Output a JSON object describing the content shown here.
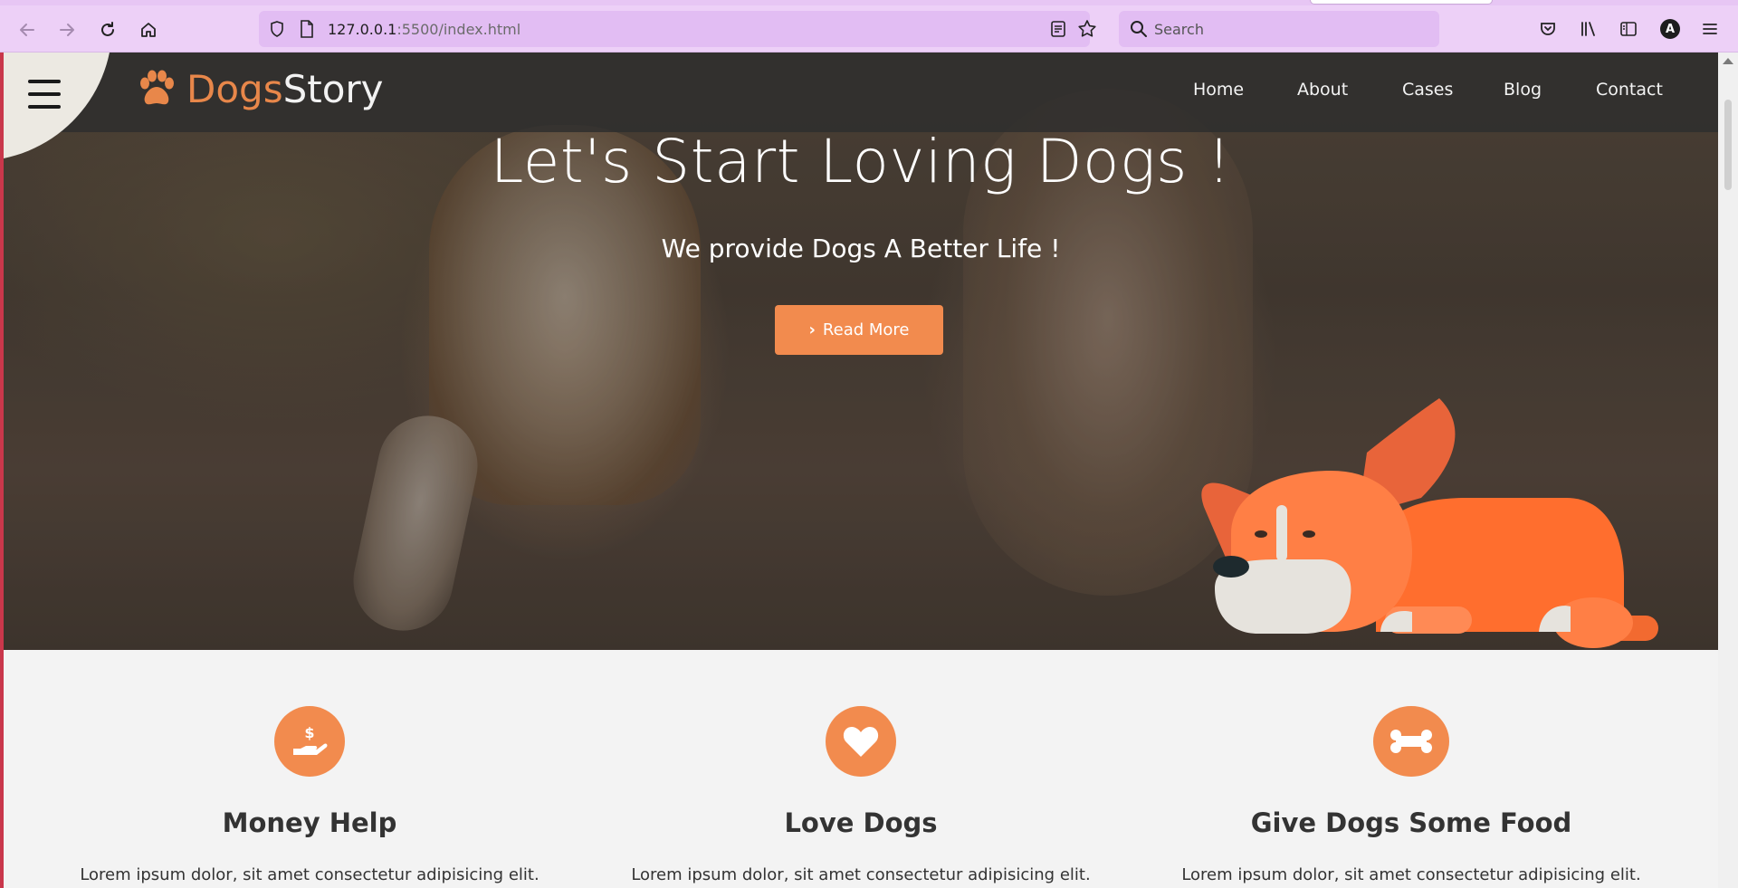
{
  "browser": {
    "url_host": "127.0.0.1",
    "url_path": ":5500/index.html",
    "search_placeholder": "Search",
    "account_initial": "A"
  },
  "brand": {
    "part1": "Dogs",
    "part2": "Story",
    "accent": "#f28b4e"
  },
  "nav": {
    "items": [
      "Home",
      "About",
      "Cases",
      "Blog",
      "Contact"
    ]
  },
  "hero": {
    "title": "Let's Start Loving Dogs !",
    "subtitle": "We provide Dogs A Better Life !",
    "button_label": "Read More"
  },
  "features": [
    {
      "icon": "hand-dollar-icon",
      "title": "Money Help",
      "description": "Lorem ipsum dolor, sit amet consectetur adipisicing elit."
    },
    {
      "icon": "heart-icon",
      "title": "Love Dogs",
      "description": "Lorem ipsum dolor, sit amet consectetur adipisicing elit."
    },
    {
      "icon": "bone-icon",
      "title": "Give Dogs Some Food",
      "description": "Lorem ipsum dolor, sit amet consectetur adipisicing elit."
    }
  ]
}
